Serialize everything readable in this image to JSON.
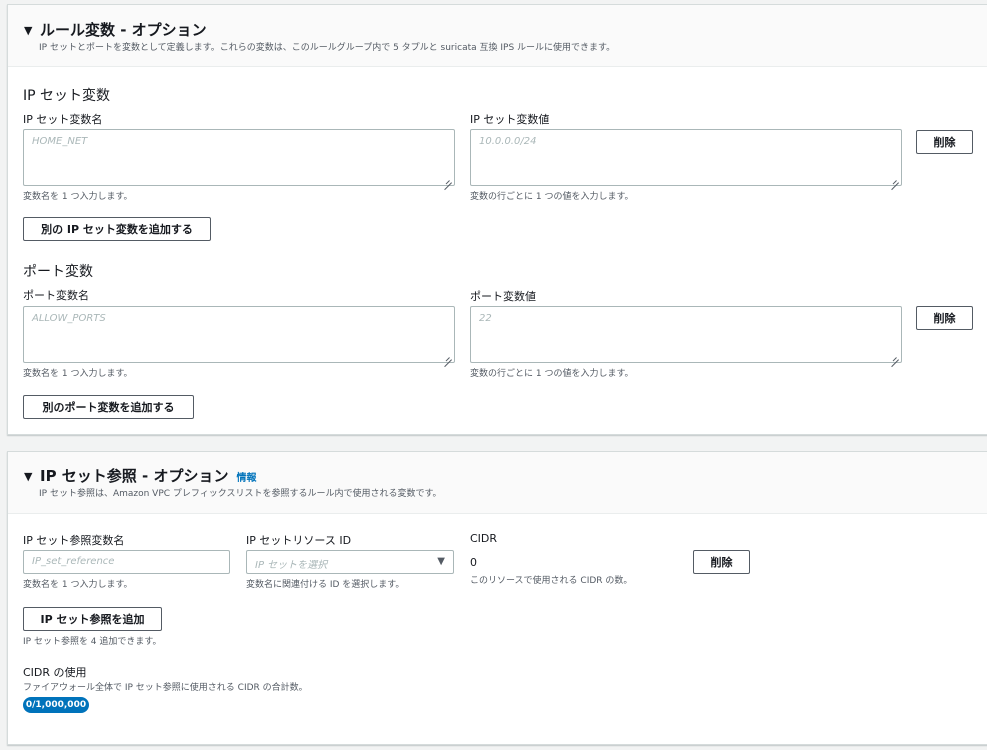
{
  "rule_variables": {
    "title": "ルール変数 - オプション",
    "description": "IP セットとポートを変数として定義します。これらの変数は、このルールグループ内で 5 タプルと suricata 互換 IPS ルールに使用できます。",
    "ip_set": {
      "heading": "IP セット変数",
      "name_label": "IP セット変数名",
      "name_placeholder": "HOME_NET",
      "name_hint": "変数名を 1 つ入力します。",
      "value_label": "IP セット変数値",
      "value_placeholder": "10.0.0.0/24",
      "value_hint": "変数の行ごとに 1 つの値を入力します。",
      "remove_label": "削除",
      "add_label": "別の IP セット変数を追加する"
    },
    "port": {
      "heading": "ポート変数",
      "name_label": "ポート変数名",
      "name_placeholder": "ALLOW_PORTS",
      "name_hint": "変数名を 1 つ入力します。",
      "value_label": "ポート変数値",
      "value_placeholder": "22",
      "value_hint": "変数の行ごとに 1 つの値を入力します。",
      "remove_label": "削除",
      "add_label": "別のポート変数を追加する"
    }
  },
  "ip_set_references": {
    "title": "IP セット参照 - オプション",
    "info_link": "情報",
    "description": "IP セット参照は、Amazon VPC プレフィックスリストを参照するルール内で使用される変数です。",
    "name_label": "IP セット参照変数名",
    "name_placeholder": "IP_set_reference",
    "name_hint": "変数名を 1 つ入力します。",
    "resource_label": "IP セットリソース ID",
    "resource_placeholder": "IP セットを選択",
    "resource_hint": "変数名に関連付ける ID を選択します。",
    "cidr_label": "CIDR",
    "cidr_value": "0",
    "cidr_hint": "このリソースで使用される CIDR の数。",
    "remove_label": "削除",
    "add_label": "IP セット参照を追加",
    "add_hint": "IP セット参照を 4 追加できます。",
    "cidr_usage_label": "CIDR の使用",
    "cidr_usage_desc": "ファイアウォール全体で IP セット参照に使用される CIDR の合計数。",
    "cidr_usage_badge": "0/1,000,000"
  }
}
